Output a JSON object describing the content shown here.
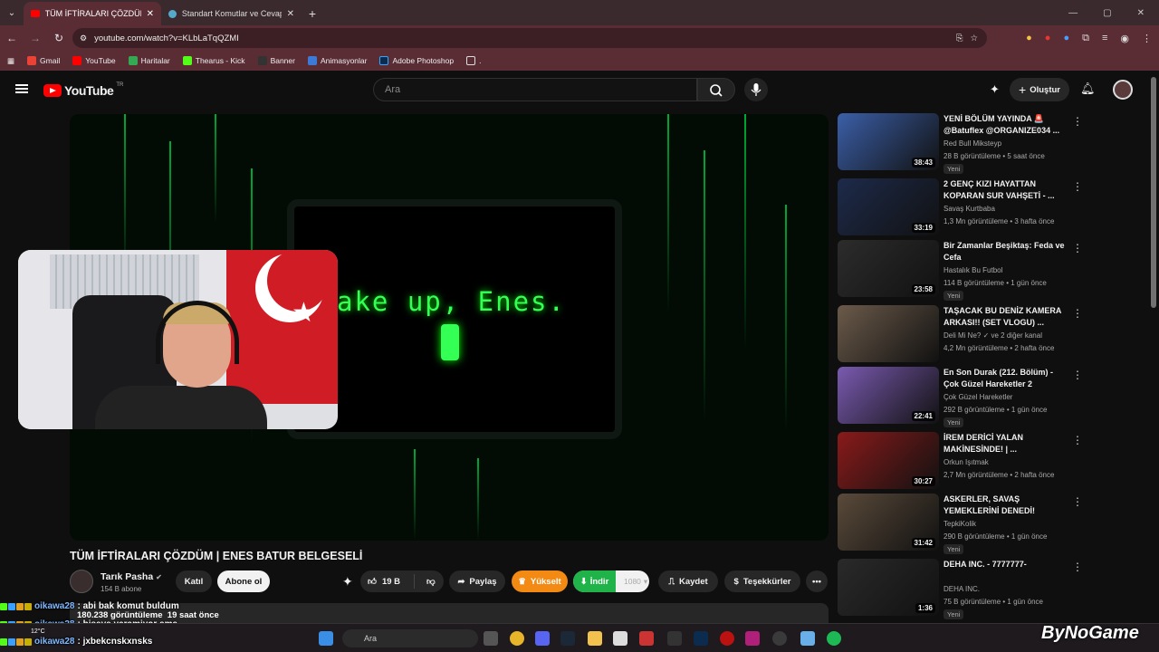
{
  "browser": {
    "tabs": [
      {
        "title": "TÜM İFTİRALARI ÇÖZDÜM | EN"
      },
      {
        "title": "Standart Komutlar ve Cevaplar"
      }
    ],
    "url": "youtube.com/watch?v=KLbLaTqQZMI",
    "bookmarks": [
      "Gmail",
      "YouTube",
      "Haritalar",
      "Thearus - Kick",
      "Banner",
      "Animasyonlar",
      "Adobe Photoshop",
      "."
    ]
  },
  "youtube": {
    "logo_text": "YouTube",
    "logo_region": "TR",
    "search_placeholder": "Ara",
    "create_label": "Oluştur"
  },
  "video": {
    "screen_text": "ake up, Enes.",
    "title": "TÜM İFTİRALARI ÇÖZDÜM | ENES BATUR BELGESELİ",
    "channel": "Tarık Pasha",
    "subscribers": "154 B abone",
    "join_label": "Katıl",
    "subscribe_label": "Abone ol",
    "likes": "19 B",
    "share_label": "Paylaş",
    "upgrade_label": "Yükselt",
    "download_label": "İndir",
    "quality": "1080",
    "save_label": "Kaydet",
    "thanks_label": "Teşekkürler",
    "stats": "180.238 görüntüleme  19 saat önce"
  },
  "recommendations": [
    {
      "title": "YENİ BÖLÜM YAYINDA 🚨 @Batuflex @ORGANIZE034 ...",
      "channel": "Red Bull Mikstеyp",
      "stats": "28 B görüntüleme • 5 saat önce",
      "badge": "Yeni",
      "duration": "38:43",
      "color": "#3b5fa8"
    },
    {
      "title": "2 GENÇ KIZI HAYATTAN KOPARAN SUR VAHŞETİ - ...",
      "channel": "Savaş Kurtbaba",
      "stats": "1,3 Mn görüntüleme • 3 hafta önce",
      "badge": "",
      "duration": "33:19",
      "color": "#1d2a4a"
    },
    {
      "title": "Bir Zamanlar Beşiktaş: Feda ve Cefa",
      "channel": "Hastalık Bu Futbol",
      "stats": "114 B görüntüleme • 1 gün önce",
      "badge": "Yeni",
      "duration": "23:58",
      "color": "#2c2c2c"
    },
    {
      "title": "TAŞACAK BU DENİZ KAMERA ARKASI!! (SET VLOGU) ...",
      "channel": "Deli Mi Ne? ✓ ve 2 diğer kanal",
      "stats": "4,2 Mn görüntüleme • 2 hafta önce",
      "badge": "",
      "duration": "",
      "color": "#6b5a4a"
    },
    {
      "title": "En Son Durak (212. Bölüm) - Çok Güzel Hareketler 2",
      "channel": "Çok Güzel Hareketler",
      "stats": "292 B görüntüleme • 1 gün önce",
      "badge": "Yeni",
      "duration": "22:41",
      "color": "#7a5ab0"
    },
    {
      "title": "İREM DERİCİ YALAN MAKİNESİNDE! | ...",
      "channel": "Orkun Işıtmak",
      "stats": "2,7 Mn görüntüleme • 2 hafta önce",
      "badge": "",
      "duration": "30:27",
      "color": "#8a1a1a"
    },
    {
      "title": "ASKERLER, SAVAŞ YEMEKLERİNİ DENEDİ!",
      "channel": "TepkiKolik",
      "stats": "290 B görüntüleme • 1 gün önce",
      "badge": "Yeni",
      "duration": "31:42",
      "color": "#5a4a3a"
    },
    {
      "title": "DEHA INC. - 7777777-",
      "channel": "DEHA INC.",
      "stats": "75 B görüntüleme • 1 gün önce",
      "badge": "Yeni",
      "duration": "1:36",
      "color": "#2a2a2a"
    }
  ],
  "chat": [
    {
      "nick": "oikawa28",
      "message": ": abi bak komut buldum"
    },
    {
      "nick": "oikawa28",
      "message": ": biseye yaramiyor ama"
    },
    {
      "nick": "oikawa28",
      "message": ": jxbekcnskxnsks"
    }
  ],
  "taskbar": {
    "search_placeholder": "Ara",
    "weather": "12°C",
    "watermark": "ByNoGame"
  }
}
